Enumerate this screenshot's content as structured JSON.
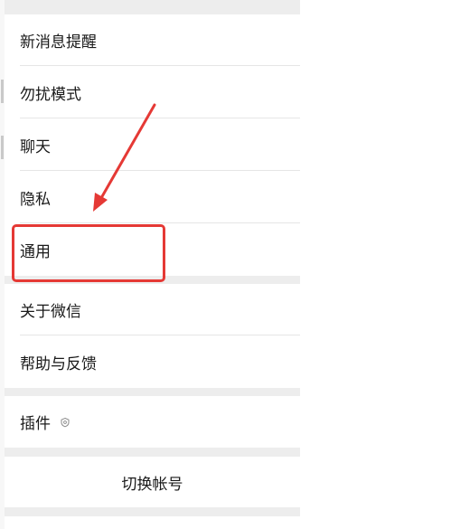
{
  "settings": {
    "items": [
      {
        "label": "新消息提醒"
      },
      {
        "label": "勿扰模式"
      },
      {
        "label": "聊天"
      },
      {
        "label": "隐私"
      },
      {
        "label": "通用"
      },
      {
        "label": "关于微信"
      },
      {
        "label": "帮助与反馈"
      },
      {
        "label": "插件",
        "icon": "plugin-icon"
      }
    ],
    "switch_account_label": "切换帐号"
  },
  "annotation": {
    "color": "#e53935",
    "highlighted_item": "通用"
  }
}
